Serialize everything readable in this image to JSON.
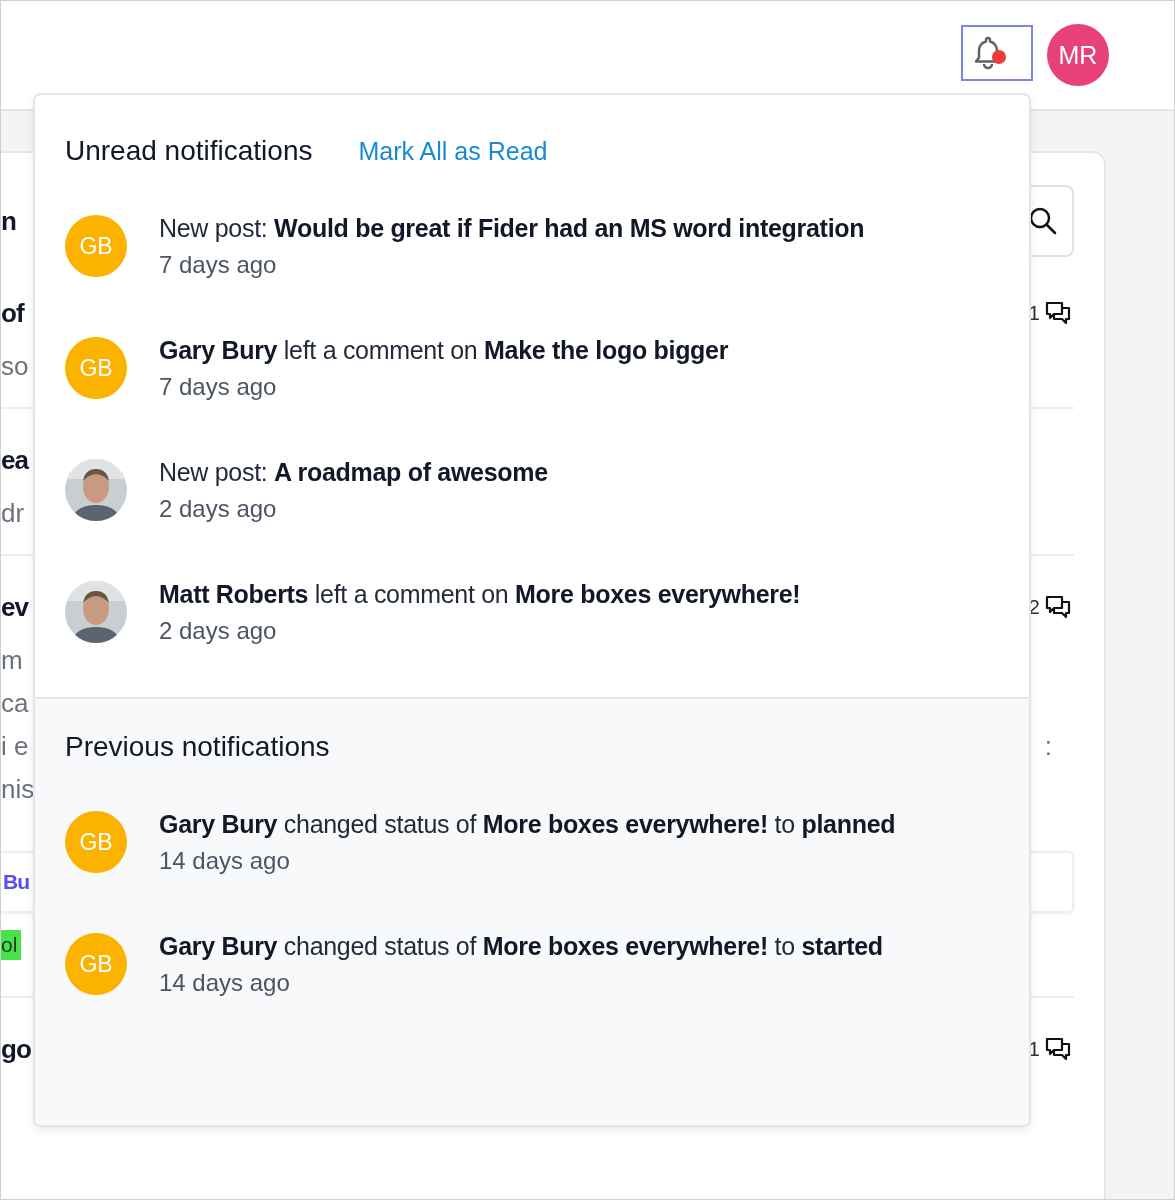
{
  "header": {
    "bell": {
      "has_unread": true
    },
    "user_avatar": "MR"
  },
  "feed": [
    {
      "kind": "search",
      "text": "n"
    },
    {
      "kind": "title",
      "text": "of",
      "count": "1"
    },
    {
      "kind": "meta",
      "text": "so"
    },
    {
      "kind": "divider"
    },
    {
      "kind": "title",
      "text": "ea"
    },
    {
      "kind": "meta",
      "text": "dr"
    },
    {
      "kind": "divider"
    },
    {
      "kind": "title",
      "text": "ev",
      "count": "2"
    },
    {
      "kind": "meta",
      "text": "m"
    },
    {
      "kind": "meta",
      "text": "ca"
    },
    {
      "kind": "meta",
      "text": "i e",
      "aside": ":"
    },
    {
      "kind": "meta",
      "text": "nis"
    },
    {
      "kind": "spacer"
    },
    {
      "kind": "box",
      "text": "Bu"
    },
    {
      "kind": "tag",
      "text": "ol"
    },
    {
      "kind": "divider"
    },
    {
      "kind": "title",
      "text": "go",
      "count": "1"
    }
  ],
  "notifications": {
    "unread_title": "Unread notifications",
    "mark_all": "Mark All as Read",
    "unread": [
      {
        "avatar": {
          "kind": "initials",
          "initials": "GB"
        },
        "text": "New post: **Would be great if Fider had an MS word integration**",
        "time": "7 days ago"
      },
      {
        "avatar": {
          "kind": "initials",
          "initials": "GB"
        },
        "text": "**Gary Bury** left a comment on **Make the logo bigger**",
        "time": "7 days ago"
      },
      {
        "text": "New post: **A roadmap of awesome**",
        "time": "2 days ago"
      },
      {
        "text": "**Matt Roberts** left a comment on **More boxes everywhere!**",
        "time": "2 days ago"
      }
    ],
    "previous_title": "Previous notifications",
    "previous": [
      {
        "avatar": {
          "kind": "initials",
          "initials": "GB"
        },
        "text": "**Gary Bury** changed status of **More boxes everywhere!** to **planned**",
        "time": "14 days ago"
      },
      {
        "avatar": {
          "kind": "initials",
          "initials": "GB"
        },
        "text": "**Gary Bury** changed status of **More boxes everywhere!** to **started**",
        "time": "14 days ago"
      }
    ]
  }
}
